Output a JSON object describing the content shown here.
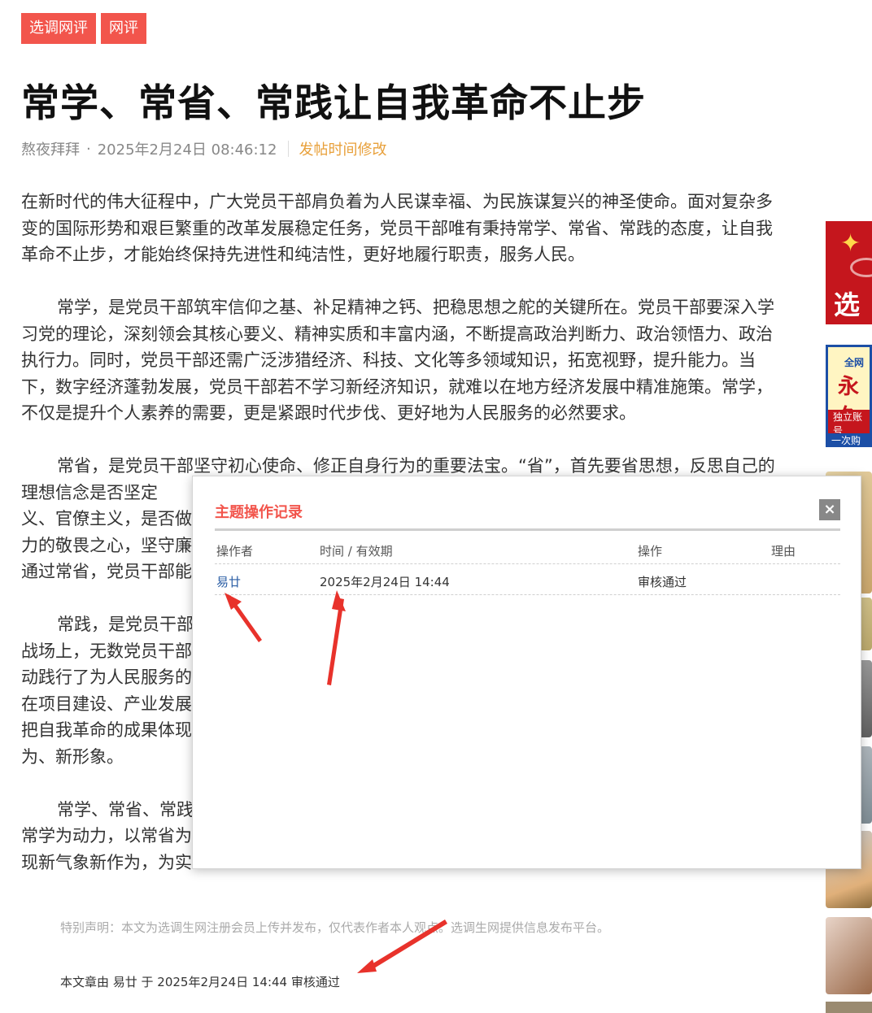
{
  "tags": [
    "选调网评",
    "网评"
  ],
  "article": {
    "title": "常学、常省、常践让自我革命不止步",
    "author": "熬夜拜拜",
    "date": "2025年2月24日 08:46:12",
    "edit_link": "发帖时间修改",
    "paragraphs": [
      "在新时代的伟大征程中，广大党员干部肩负着为人民谋幸福、为民族谋复兴的神圣使命。面对复杂多变的国际形势和艰巨繁重的改革发展稳定任务，党员干部唯有秉持常学、常省、常践的态度，让自我革命不止步，才能始终保持先进性和纯洁性，更好地履行职责，服务人民。",
      "常学，是党员干部筑牢信仰之基、补足精神之钙、把稳思想之舵的关键所在。党员干部要深入学习党的理论，深刻领会其核心要义、精神实质和丰富内涵，不断提高政治判断力、政治领悟力、政治执行力。同时，党员干部还需广泛涉猎经济、科技、文化等多领域知识，拓宽视野，提升能力。当下，数字经济蓬勃发展，党员干部若不学习新经济知识，就难以在地方经济发展中精准施策。常学，不仅是提升个人素养的需要，更是紧跟时代步伐、更好地为人民服务的必然要求。",
      "常省，是党员干部坚守初心使命、修正自身行为的重要法宝。“省”，首先要省思想，反思自己的理想信念是否坚定",
      "义、官僚主义，是否做",
      "力的敬畏之心，坚守廉",
      "通过常省，党员干部能",
      "常践，是党员干部",
      "战场上，无数党员干部",
      "动践行了为人民服务的",
      "在项目建设、产业发展",
      "把自我革命的成果体现",
      "为、新形象。",
      "常学、常省、常践",
      "常学为动力，以常省为",
      "现新气象新作为，为实"
    ],
    "notice": "特别声明：本文为选调生网注册会员上传并发布，仅代表作者本人观点。选调生网提供信息发布平台。",
    "audit_line": "本文章由 易廿 于 2025年2月24日 14:44 审核通过"
  },
  "sidebar_ads": {
    "ad1_text": "选调",
    "ad2_lines": [
      "全网",
      "永久",
      "独立账号",
      "一次购买"
    ]
  },
  "modal": {
    "title": "主题操作记录",
    "close": "×",
    "columns": [
      "操作者",
      "时间 / 有效期",
      "操作",
      "理由"
    ],
    "records": [
      {
        "operator": "易廿",
        "time": "2025年2月24日 14:44",
        "action": "审核通过",
        "reason": ""
      }
    ]
  },
  "colors": {
    "accent_red": "#f2554c",
    "edit_orange": "#e8a03a",
    "link_blue": "#2b5ea5",
    "annotation_arrow": "#e8322b"
  }
}
